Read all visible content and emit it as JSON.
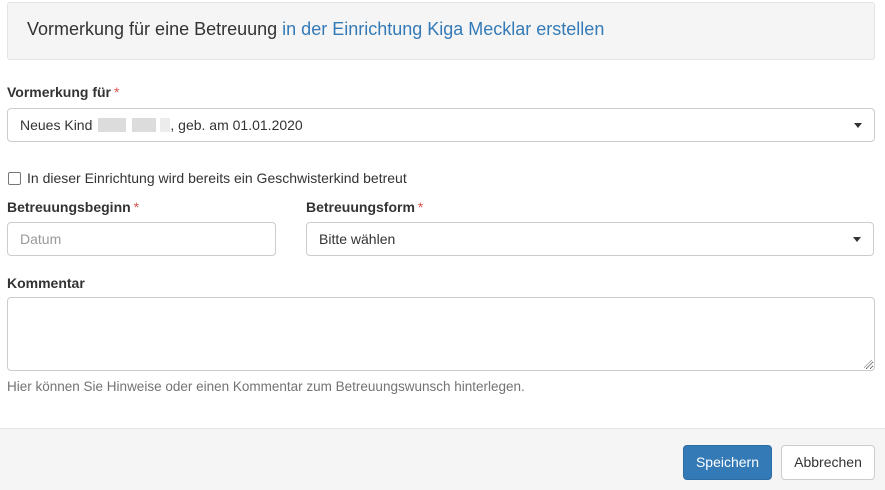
{
  "header": {
    "title_prefix": "Vormerkung für eine Betreuung",
    "title_link": "in der Einrichtung Kiga Mecklar erstellen"
  },
  "form": {
    "vormerkung_label": "Vormerkung für",
    "required_marker": "*",
    "child_select": {
      "prefix": "Neues Kind",
      "suffix": ", geb. am 01.01.2020"
    },
    "sibling_checkbox_label": "In dieser Einrichtung wird bereits ein Geschwisterkind betreut",
    "sibling_checked": false,
    "start_label": "Betreuungsbeginn",
    "start_placeholder": "Datum",
    "form_label": "Betreuungsform",
    "form_select_value": "Bitte wählen",
    "comment_label": "Kommentar",
    "comment_value": "",
    "comment_help": "Hier können Sie Hinweise oder einen Kommentar zum Betreuungswunsch hinterlegen."
  },
  "footer": {
    "save_label": "Speichern",
    "cancel_label": "Abbrechen"
  },
  "colors": {
    "primary": "#337ab7",
    "link": "#337ab7",
    "required": "#d9534f"
  }
}
